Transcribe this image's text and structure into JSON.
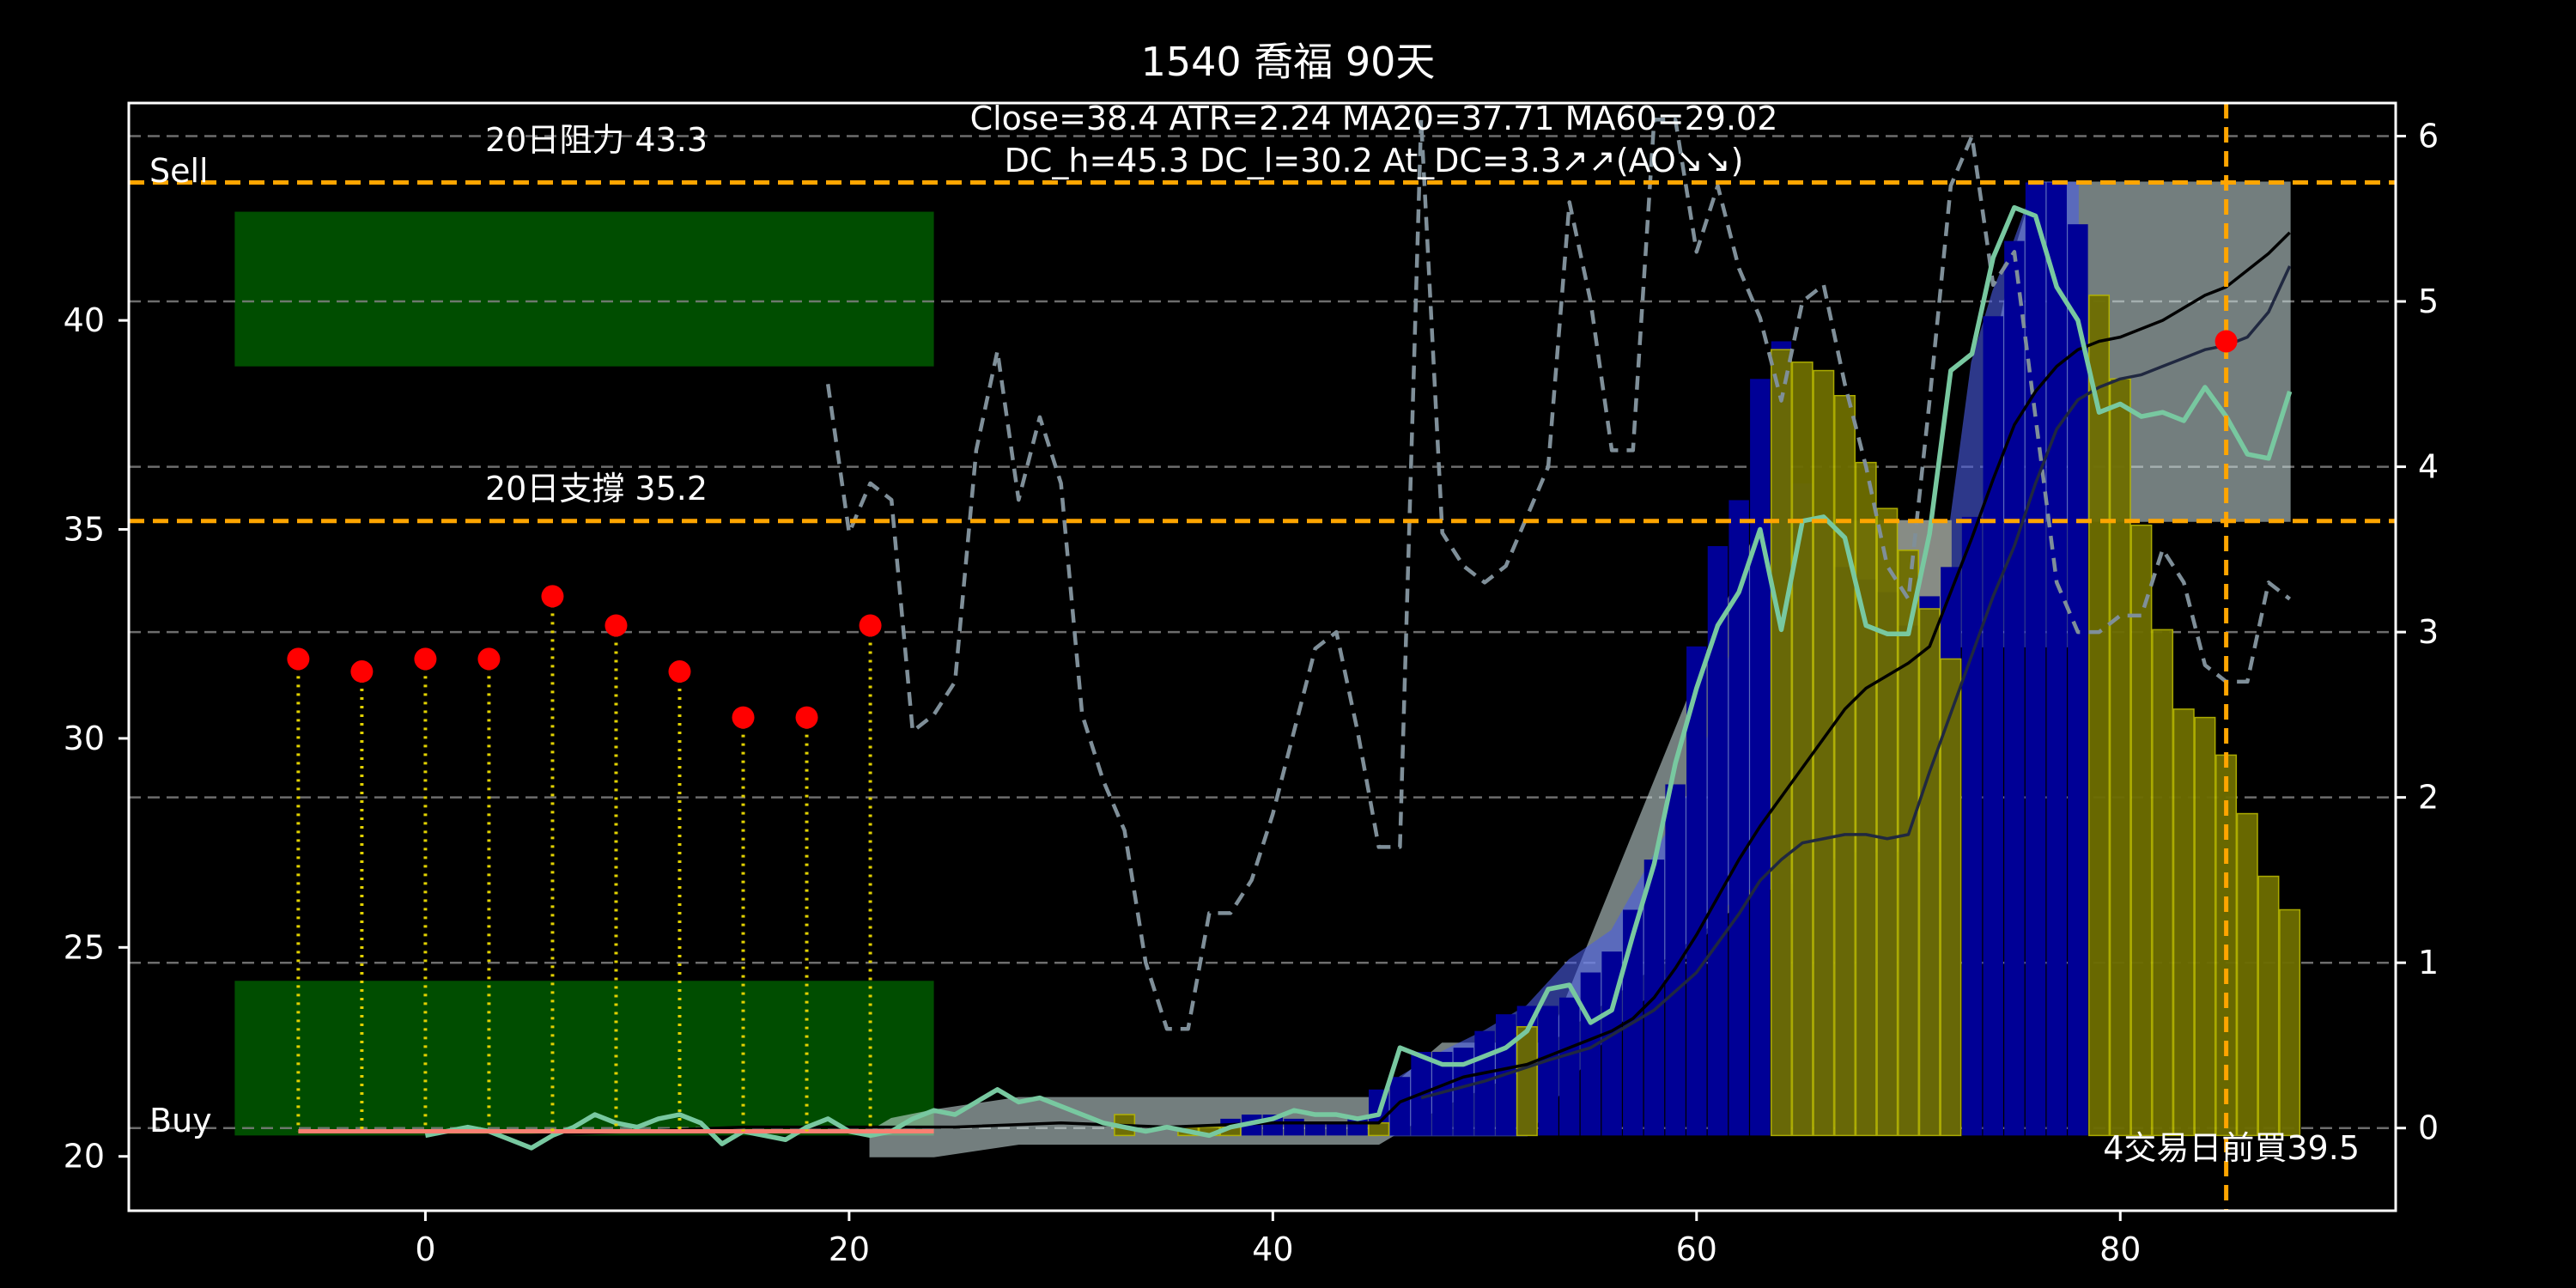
{
  "chart_data": {
    "type": "bar",
    "title": "1540 喬福 90天",
    "annotations": {
      "stats_line1": "Close=38.4 ATR=2.24 MA20=37.71 MA60=29.02",
      "stats_line2": "DC_h=45.3 DC_l=30.2 At_DC=3.3↗↗(AO↘↘)",
      "resistance_label": "20日阻力 43.3",
      "support_label": "20日支撐 35.2",
      "sell_label": "Sell",
      "buy_label": "Buy",
      "bottom_note": "4交易日前買39.5"
    },
    "xlim": [
      -14,
      93
    ],
    "ylim": [
      18.7,
      45.2
    ],
    "y2lim": [
      -0.5,
      6.2
    ],
    "x_ticks": [
      "0",
      "20",
      "40",
      "60",
      "80"
    ],
    "x_tick_values": [
      0,
      20,
      40,
      60,
      80
    ],
    "y_ticks": [
      "20",
      "25",
      "30",
      "35",
      "40"
    ],
    "y_tick_values": [
      20,
      25,
      30,
      35,
      40
    ],
    "y2_ticks": [
      "0",
      "1",
      "2",
      "3",
      "4",
      "5",
      "6"
    ],
    "y2_tick_values": [
      0,
      1,
      2,
      3,
      4,
      5,
      6
    ],
    "grid_y2": [
      0,
      1,
      2,
      3,
      4,
      5,
      6
    ],
    "resistance": 43.3,
    "support": 35.2,
    "vline_x": 85,
    "sell_zone": {
      "x": [
        -9,
        24
      ],
      "y": [
        38.9,
        42.6
      ]
    },
    "buy_zone": {
      "x": [
        -9,
        24
      ],
      "y": [
        20.5,
        24.2
      ]
    },
    "buy_line": {
      "x": [
        -6,
        24
      ],
      "y": 20.6
    },
    "signal_points": [
      {
        "x": -6,
        "y": 31.9
      },
      {
        "x": -3,
        "y": 31.6
      },
      {
        "x": 0,
        "y": 31.9
      },
      {
        "x": 3,
        "y": 31.9
      },
      {
        "x": 6,
        "y": 33.4
      },
      {
        "x": 9,
        "y": 32.7
      },
      {
        "x": 12,
        "y": 31.6
      },
      {
        "x": 15,
        "y": 30.5
      },
      {
        "x": 18,
        "y": 30.5
      },
      {
        "x": 21,
        "y": 32.7
      },
      {
        "x": 85,
        "y": 39.5
      }
    ],
    "blue_bars": {
      "x": [
        38,
        39,
        40,
        41,
        42,
        43,
        44,
        45,
        46,
        47,
        48,
        49,
        50,
        51,
        52,
        53,
        54,
        55,
        56,
        57,
        58,
        59,
        60,
        61,
        62,
        63,
        64,
        65,
        66,
        67,
        68,
        69,
        70,
        71,
        72,
        73,
        74,
        75,
        76,
        77,
        78
      ],
      "values": [
        20.9,
        21.0,
        21.0,
        20.9,
        20.8,
        20.8,
        20.9,
        21.6,
        21.9,
        22.5,
        22.5,
        22.6,
        23.0,
        23.4,
        23.6,
        23.6,
        23.8,
        24.4,
        24.9,
        25.9,
        27.1,
        28.9,
        32.2,
        34.6,
        35.7,
        38.6,
        39.5,
        36.1,
        35.3,
        34.1,
        33.8,
        33.5,
        32.7,
        33.4,
        34.1,
        35.3,
        40.1,
        41.9,
        43.3,
        43.3,
        42.3
      ]
    },
    "olive_bars": {
      "x": [
        33,
        36,
        37,
        38,
        45,
        52,
        64,
        65,
        66,
        67,
        68,
        69,
        70,
        71,
        72,
        79,
        80,
        81,
        82,
        83,
        84,
        85,
        86,
        87,
        88
      ],
      "values": [
        21.0,
        20.7,
        20.7,
        20.7,
        20.8,
        23.1,
        39.3,
        39.0,
        38.8,
        38.2,
        36.6,
        35.5,
        34.5,
        33.1,
        31.9,
        40.6,
        38.6,
        35.1,
        32.6,
        30.7,
        30.5,
        29.6,
        28.2,
        26.7,
        25.9
      ]
    },
    "light_bands": [
      {
        "x": [
          21,
          22,
          24,
          28,
          36,
          37,
          44,
          45,
          48,
          52,
          53,
          63
        ],
        "low": [
          20.0,
          20.0,
          20.0,
          20.3,
          20.3,
          20.3,
          20.3,
          20.3,
          21.2,
          22.1,
          22.7,
          26.4
        ],
        "high": [
          20.6,
          20.9,
          21.1,
          21.4,
          21.4,
          21.4,
          21.4,
          21.4,
          22.7,
          22.7,
          22.7,
          35.2
        ]
      },
      {
        "x": [
          64,
          67,
          69,
          72
        ],
        "low": [
          26.4,
          27.3,
          27.3,
          27.3
        ],
        "high": [
          35.2,
          35.2,
          35.2,
          35.2
        ]
      },
      {
        "x": [
          74,
          75,
          76,
          77,
          78,
          85,
          88
        ],
        "low": [
          35.2,
          35.2,
          35.2,
          35.2,
          35.2,
          35.2,
          35.2
        ],
        "high": [
          39.1,
          41.6,
          43.3,
          43.3,
          43.3,
          43.3,
          43.3
        ]
      }
    ],
    "price": {
      "x": [
        0,
        1,
        2,
        3,
        4,
        5,
        6,
        7,
        8,
        9,
        10,
        11,
        12,
        13,
        14,
        15,
        16,
        17,
        18,
        19,
        20,
        21,
        22,
        23,
        24,
        25,
        26,
        27,
        28,
        29,
        30,
        31,
        32,
        33,
        34,
        35,
        36,
        37,
        38,
        39,
        40,
        41,
        42,
        43,
        44,
        45,
        46,
        47,
        48,
        49,
        50,
        51,
        52,
        53,
        54,
        55,
        56,
        57,
        58,
        59,
        60,
        61,
        62,
        63,
        64,
        65,
        66,
        67,
        68,
        69,
        70,
        71,
        72,
        73,
        74,
        75,
        76,
        77,
        78,
        79,
        80,
        81,
        82,
        83,
        84,
        85,
        86,
        87,
        88
      ],
      "values": [
        20.5,
        20.6,
        20.7,
        20.6,
        20.4,
        20.2,
        20.5,
        20.7,
        21.0,
        20.8,
        20.7,
        20.9,
        21.0,
        20.8,
        20.3,
        20.6,
        20.5,
        20.4,
        20.7,
        20.9,
        20.6,
        20.5,
        20.6,
        20.9,
        21.1,
        21.0,
        21.3,
        21.6,
        21.3,
        21.4,
        21.2,
        21.0,
        20.8,
        20.7,
        20.6,
        20.7,
        20.6,
        20.5,
        20.7,
        20.8,
        20.9,
        21.1,
        21.0,
        21.0,
        20.9,
        21.0,
        22.6,
        22.4,
        22.2,
        22.2,
        22.4,
        22.6,
        23.0,
        24.0,
        24.1,
        23.2,
        23.5,
        25.3,
        27.0,
        29.4,
        31.2,
        32.7,
        33.5,
        35.0,
        32.6,
        35.2,
        35.3,
        34.8,
        32.7,
        32.5,
        32.5,
        34.9,
        38.8,
        39.2,
        41.5,
        42.7,
        42.5,
        40.8,
        40.0,
        37.8,
        38.0,
        37.7,
        37.8,
        37.6,
        38.4,
        37.7,
        36.8,
        36.7,
        38.3
      ]
    },
    "ma_line": {
      "x": [
        0,
        5,
        10,
        15,
        20,
        25,
        30,
        35,
        40,
        45,
        46,
        47,
        48,
        49,
        50,
        51,
        52,
        53,
        54,
        55,
        56,
        57,
        58,
        59,
        60,
        61,
        62,
        63,
        64,
        65,
        66,
        67,
        68,
        69,
        70,
        71,
        72,
        73,
        74,
        75,
        76,
        77,
        78,
        79,
        80,
        81,
        82,
        83,
        84,
        85,
        86,
        87,
        88
      ],
      "values": [
        20.5,
        20.5,
        20.6,
        20.7,
        20.7,
        20.7,
        20.8,
        20.7,
        20.8,
        20.8,
        21.3,
        21.5,
        21.7,
        21.9,
        22.0,
        22.1,
        22.2,
        22.4,
        22.6,
        22.8,
        23.0,
        23.3,
        23.8,
        24.5,
        25.3,
        26.2,
        27.1,
        27.9,
        28.6,
        29.3,
        30.0,
        30.7,
        31.2,
        31.5,
        31.8,
        32.2,
        33.5,
        34.8,
        36.2,
        37.5,
        38.3,
        38.9,
        39.3,
        39.5,
        39.6,
        39.8,
        40.0,
        40.3,
        40.6,
        40.8,
        41.2,
        41.6,
        42.1
      ]
    },
    "ma_line2": {
      "x": [
        47,
        50,
        53,
        55,
        58,
        60,
        61,
        62,
        63,
        64,
        65,
        66,
        67,
        68,
        69,
        70,
        71,
        72,
        73,
        74,
        75,
        76,
        77,
        78,
        79,
        80,
        81,
        82,
        83,
        84,
        85,
        86,
        87,
        88
      ],
      "values": [
        21.4,
        21.8,
        22.3,
        22.6,
        23.5,
        24.4,
        25.1,
        25.8,
        26.6,
        27.1,
        27.5,
        27.6,
        27.7,
        27.7,
        27.6,
        27.7,
        29.2,
        30.6,
        32.0,
        33.4,
        34.6,
        36.1,
        37.4,
        38.1,
        38.4,
        38.6,
        38.7,
        38.9,
        39.1,
        39.3,
        39.4,
        39.6,
        40.2,
        41.3
      ]
    },
    "atr_series": {
      "x": [
        19,
        20,
        21,
        22,
        23,
        24,
        25,
        26,
        27,
        28,
        29,
        30,
        31,
        32,
        33,
        34,
        35,
        36,
        37,
        38,
        39,
        40,
        41,
        42,
        43,
        44,
        45,
        46,
        47,
        48,
        49,
        50,
        51,
        52,
        53,
        54,
        55,
        56,
        57,
        58,
        59,
        60,
        61,
        62,
        63,
        64,
        65,
        66,
        67,
        68,
        69,
        70,
        71,
        72,
        73,
        74,
        75,
        76,
        77,
        78,
        79,
        80,
        81,
        82,
        83,
        84,
        85,
        86,
        87,
        88
      ],
      "values": [
        4.5,
        3.6,
        3.9,
        3.8,
        2.4,
        2.5,
        2.7,
        4.1,
        4.7,
        3.8,
        4.3,
        3.9,
        2.5,
        2.1,
        1.8,
        1.0,
        0.6,
        0.6,
        1.3,
        1.3,
        1.5,
        1.9,
        2.4,
        2.9,
        3.0,
        2.4,
        1.7,
        1.7,
        6.1,
        3.6,
        3.4,
        3.3,
        3.4,
        3.7,
        4.0,
        5.6,
        5.0,
        4.1,
        4.1,
        6.1,
        6.1,
        5.3,
        5.7,
        5.2,
        4.9,
        4.4,
        5.0,
        5.1,
        4.5,
        4.0,
        3.4,
        3.2,
        4.4,
        5.7,
        6.0,
        5.1,
        5.3,
        4.3,
        3.3,
        3.0,
        3.0,
        3.1,
        3.1,
        3.5,
        3.3,
        2.8,
        2.7,
        2.7,
        3.3,
        3.2
      ]
    },
    "colors": {
      "background": "#000000",
      "axes": "#ffffff",
      "grid": "#808080",
      "level_line": "#ffa500",
      "zone": "#004d00",
      "buy_line": "#fa8072",
      "signal": "#ff0000",
      "stem": "#e0d000",
      "blue_bar": "#000096",
      "blue_band": "#4b5ee6",
      "olive_bar": "#6e6e00",
      "olive_edge": "#b4b400",
      "light_band": "#d2d282",
      "gray_band": "#d2e6e6",
      "price": "#78c8a0",
      "ma": "#000000",
      "ma2": "#202840",
      "atr": "#7f8f99"
    }
  }
}
